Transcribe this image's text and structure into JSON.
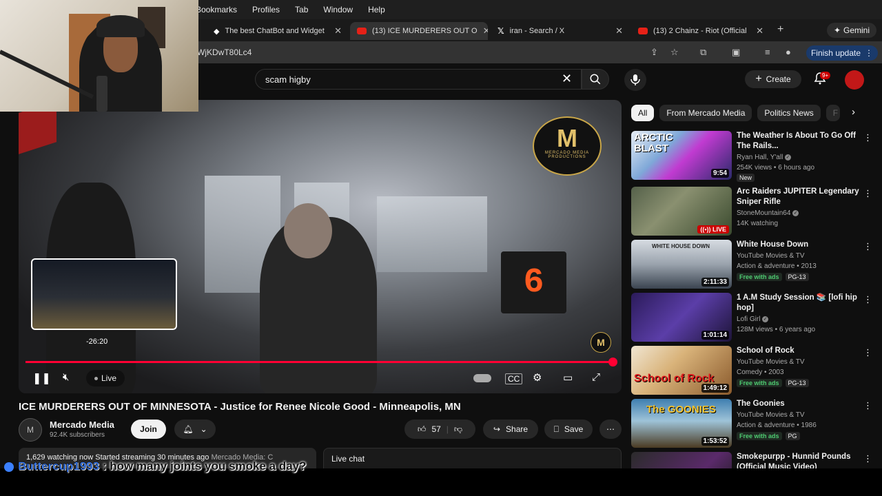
{
  "menubar": {
    "items": [
      "Bookmarks",
      "Profiles",
      "Tab",
      "Window",
      "Help"
    ]
  },
  "tabs": [
    {
      "title": "The best ChatBot and Widget",
      "icon": "chatbot-icon"
    },
    {
      "title": "(13) ICE MURDERERS OUT O",
      "icon": "youtube-icon"
    },
    {
      "title": "iran - Search / X",
      "icon": "x-logo-icon"
    },
    {
      "title": "(13) 2 Chainz - Riot (Official",
      "icon": "youtube-icon"
    }
  ],
  "gemini_label": "Gemini",
  "address": {
    "url": "WjKDwT80Lc4",
    "finish_update": "Finish update"
  },
  "search": {
    "query": "scam higby"
  },
  "header": {
    "create_label": "Create",
    "notif_count": "9+"
  },
  "video": {
    "preview_time": "-26:20",
    "live_label": "Live",
    "progress": 0.998,
    "brand_text": "MERCADO MEDIA PRODUCTIONS",
    "sign_digits": "6"
  },
  "title": "ICE MURDERERS OUT OF MINNESOTA - Justice for Renee Nicole Good - Minneapolis, MN",
  "channel": {
    "name": "Mercado Media",
    "subscribers": "92.4K subscribers",
    "join_label": "Join"
  },
  "actions": {
    "likes": "57",
    "share_label": "Share",
    "save_label": "Save"
  },
  "description": {
    "stats": "1,629 watching now  Started streaming 30 minutes ago",
    "preview": "Mercado Media: C"
  },
  "live_chat_label": "Live chat",
  "chips": [
    "All",
    "From Mercado Media",
    "Politics News",
    "F"
  ],
  "recommendations": [
    {
      "title": "The Weather Is About To Go Off The Rails...",
      "channel": "Ryan Hall, Y'all",
      "meta": "254K views • 6 hours ago",
      "badge": "New",
      "duration": "9:54",
      "thumb_text": "ARCTIC BLAST"
    },
    {
      "title": "Arc Raiders JUPITER Legendary Sniper Rifle",
      "channel": "StoneMountain64",
      "meta": "14K watching",
      "live": "LIVE"
    },
    {
      "title": "White House Down",
      "channel": "YouTube Movies & TV",
      "meta": "Action & adventure • 2013",
      "badge": "Free with ads",
      "rating": "PG-13",
      "duration": "2:11:33",
      "thumb_text": "WHITE HOUSE DOWN"
    },
    {
      "title": "1 A.M Study Session 📚 [lofi hip hop]",
      "channel": "Lofi Girl",
      "meta": "128M views • 6 years ago",
      "duration": "1:01:14"
    },
    {
      "title": "School of Rock",
      "channel": "YouTube Movies & TV",
      "meta": "Comedy • 2003",
      "badge": "Free with ads",
      "rating": "PG-13",
      "duration": "1:49:12",
      "thumb_text": "School of Rock"
    },
    {
      "title": "The Goonies",
      "channel": "YouTube Movies & TV",
      "meta": "Action & adventure • 1986",
      "badge": "Free with ads",
      "rating": "PG",
      "duration": "1:53:52",
      "thumb_text": "The GOONIES"
    },
    {
      "title": "Smokepurpp - Hunnid Pounds (Official Music Video)"
    }
  ],
  "overlay_chat": {
    "username": "Buttercup1993",
    "message": "how many joints you smoke a day?"
  },
  "colors": {
    "accent_red": "#ff0033",
    "bg": "#0f0f0f",
    "chat_user": "#3b80ff"
  }
}
